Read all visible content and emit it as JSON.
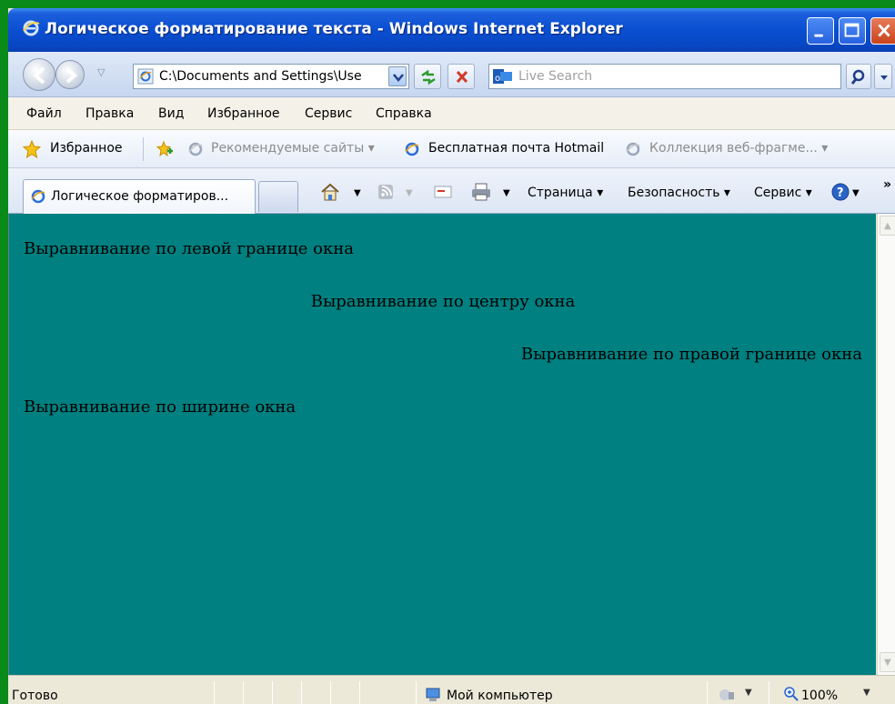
{
  "window": {
    "title": "Логическое форматирование текста - Windows Internet Explorer"
  },
  "navbar": {
    "address": "C:\\Documents and Settings\\Use",
    "search_placeholder": "Live Search"
  },
  "menubar": {
    "items": [
      "Файл",
      "Правка",
      "Вид",
      "Избранное",
      "Сервис",
      "Справка"
    ]
  },
  "favbar": {
    "favorites_label": "Избранное",
    "links": [
      {
        "label": "Рекомендуемые сайты ▾"
      },
      {
        "label": "Бесплатная почта Hotmail"
      },
      {
        "label": "Коллекция веб-фрагме... ▾"
      }
    ]
  },
  "tabs": {
    "active_label": "Логическое форматиров..."
  },
  "commandbar": {
    "page": "Страница ▾",
    "safety": "Безопасность ▾",
    "tools": "Сервис ▾",
    "more": "»"
  },
  "content": {
    "left": "Выравнивание по левой границе окна",
    "center": "Выравнивание по центру окна",
    "right": "Выравнивание по правой границе окна",
    "justify": "Выравнивание по ширине окна",
    "background": "#008080"
  },
  "statusbar": {
    "status": "Готово",
    "zone": "Мой компьютер",
    "zoom": "100%"
  }
}
